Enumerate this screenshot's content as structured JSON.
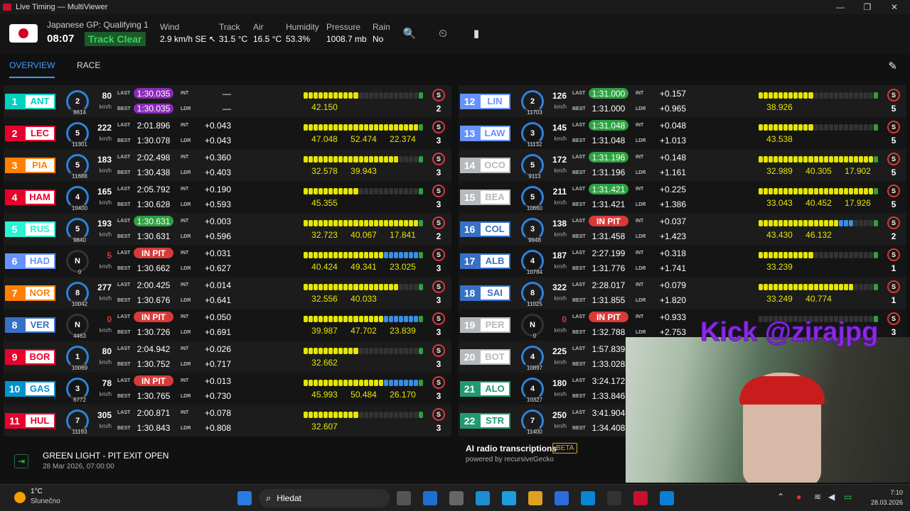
{
  "window": {
    "title": "Live Timing — MultiViewer"
  },
  "header": {
    "session": "Japanese GP: Qualifying 1",
    "clock": "08:07",
    "status": "Track Clear",
    "weather": [
      {
        "label": "Wind",
        "value": "2.9 km/h SE ↖"
      },
      {
        "label": "Track",
        "value": "31.5 °C"
      },
      {
        "label": "Air",
        "value": "16.5 °C"
      },
      {
        "label": "Humidity",
        "value": "53.3%"
      },
      {
        "label": "Pressure",
        "value": "1008.7 mb"
      },
      {
        "label": "Rain",
        "value": "No"
      }
    ]
  },
  "tabs": {
    "overview": "OVERVIEW",
    "race": "RACE"
  },
  "labels": {
    "last": "LAST",
    "best": "BEST",
    "int": "INT",
    "ldr": "LDR",
    "kmh": "km/h"
  },
  "colors": {
    "purple": "#8a2bb8",
    "green": "#2ea041",
    "pit": "#d83a3a",
    "yellow": "#e6e600"
  },
  "drivers": [
    {
      "pos": "1",
      "code": "ANT",
      "team": "#00d2be",
      "gear": "2",
      "rpm": "8614",
      "speed": "80",
      "last": "1:30.035",
      "lastStyle": "purple",
      "best": "1:30.035",
      "bestStyle": "purple",
      "int": "—",
      "ldr": "—",
      "s1": "42.150",
      "s2": "",
      "s3": "",
      "tyre": "S",
      "laps": "2"
    },
    {
      "pos": "2",
      "code": "LEC",
      "team": "#e8002d",
      "gear": "5",
      "rpm": "11301",
      "speed": "222",
      "last": "2:01.896",
      "lastStyle": "",
      "best": "1:30.078",
      "bestStyle": "",
      "int": "+0.043",
      "ldr": "+0.043",
      "s1": "47.048",
      "s2": "52.474",
      "s3": "22.374",
      "tyre": "S",
      "laps": "3"
    },
    {
      "pos": "3",
      "code": "PIA",
      "team": "#ff8000",
      "gear": "5",
      "rpm": "11688",
      "speed": "183",
      "last": "2:02.498",
      "lastStyle": "",
      "best": "1:30.438",
      "bestStyle": "",
      "int": "+0.360",
      "ldr": "+0.403",
      "s1": "32.578",
      "s2": "39.943",
      "s3": "",
      "tyre": "S",
      "laps": "3"
    },
    {
      "pos": "4",
      "code": "HAM",
      "team": "#e8002d",
      "gear": "4",
      "rpm": "10400",
      "speed": "165",
      "last": "2:05.792",
      "lastStyle": "",
      "best": "1:30.628",
      "bestStyle": "",
      "int": "+0.190",
      "ldr": "+0.593",
      "s1": "45.355",
      "s2": "",
      "s3": "",
      "tyre": "S",
      "laps": "3"
    },
    {
      "pos": "5",
      "code": "RUS",
      "team": "#27f4d2",
      "gear": "5",
      "rpm": "9840",
      "speed": "193",
      "last": "1:30.631",
      "lastStyle": "green",
      "best": "1:30.631",
      "bestStyle": "",
      "int": "+0.003",
      "ldr": "+0.596",
      "s1": "32.723",
      "s2": "40.067",
      "s3": "17.841",
      "tyre": "S",
      "laps": "2"
    },
    {
      "pos": "6",
      "code": "HAD",
      "team": "#6692ff",
      "gear": "N",
      "rpm": "0",
      "speed": "5",
      "last": "IN PIT",
      "lastStyle": "pit",
      "best": "1:30.662",
      "bestStyle": "",
      "int": "+0.031",
      "ldr": "+0.627",
      "s1": "40.424",
      "s2": "49.341",
      "s3": "23.025",
      "tyre": "S",
      "laps": "3"
    },
    {
      "pos": "7",
      "code": "NOR",
      "team": "#ff8000",
      "gear": "8",
      "rpm": "10042",
      "speed": "277",
      "last": "2:00.425",
      "lastStyle": "",
      "best": "1:30.676",
      "bestStyle": "",
      "int": "+0.014",
      "ldr": "+0.641",
      "s1": "32.556",
      "s2": "40.033",
      "s3": "",
      "tyre": "S",
      "laps": "3"
    },
    {
      "pos": "8",
      "code": "VER",
      "team": "#3671c6",
      "gear": "N",
      "rpm": "4463",
      "speed": "0",
      "last": "IN PIT",
      "lastStyle": "pit",
      "best": "1:30.726",
      "bestStyle": "",
      "int": "+0.050",
      "ldr": "+0.691",
      "s1": "39.987",
      "s2": "47.702",
      "s3": "23.839",
      "tyre": "S",
      "laps": "3"
    },
    {
      "pos": "9",
      "code": "BOR",
      "team": "#e8002d",
      "gear": "1",
      "rpm": "10069",
      "speed": "80",
      "last": "2:04.942",
      "lastStyle": "",
      "best": "1:30.752",
      "bestStyle": "",
      "int": "+0.026",
      "ldr": "+0.717",
      "s1": "32.662",
      "s2": "",
      "s3": "",
      "tyre": "S",
      "laps": "3"
    },
    {
      "pos": "10",
      "code": "GAS",
      "team": "#0093cc",
      "gear": "3",
      "rpm": "6772",
      "speed": "78",
      "last": "IN PIT",
      "lastStyle": "pit",
      "best": "1:30.765",
      "bestStyle": "",
      "int": "+0.013",
      "ldr": "+0.730",
      "s1": "45.993",
      "s2": "50.484",
      "s3": "26.170",
      "tyre": "S",
      "laps": "3"
    },
    {
      "pos": "11",
      "code": "HUL",
      "team": "#e8002d",
      "gear": "7",
      "rpm": "11193",
      "speed": "305",
      "last": "2:00.871",
      "lastStyle": "",
      "best": "1:30.843",
      "bestStyle": "",
      "int": "+0.078",
      "ldr": "+0.808",
      "s1": "32.607",
      "s2": "",
      "s3": "",
      "tyre": "S",
      "laps": "3"
    },
    {
      "pos": "12",
      "code": "LIN",
      "team": "#6692ff",
      "gear": "2",
      "rpm": "11703",
      "speed": "126",
      "last": "1:31.000",
      "lastStyle": "green",
      "best": "1:31.000",
      "bestStyle": "",
      "int": "+0.157",
      "ldr": "+0.965",
      "s1": "38.926",
      "s2": "",
      "s3": "",
      "tyre": "S",
      "laps": "5"
    },
    {
      "pos": "13",
      "code": "LAW",
      "team": "#6692ff",
      "gear": "3",
      "rpm": "11132",
      "speed": "145",
      "last": "1:31.048",
      "lastStyle": "green",
      "best": "1:31.048",
      "bestStyle": "",
      "int": "+0.048",
      "ldr": "+1.013",
      "s1": "43.538",
      "s2": "",
      "s3": "",
      "tyre": "S",
      "laps": "5"
    },
    {
      "pos": "14",
      "code": "OCO",
      "team": "#b6babd",
      "gear": "5",
      "rpm": "9113",
      "speed": "172",
      "last": "1:31.196",
      "lastStyle": "green",
      "best": "1:31.196",
      "bestStyle": "",
      "int": "+0.148",
      "ldr": "+1.161",
      "s1": "32.989",
      "s2": "40.305",
      "s3": "17.902",
      "tyre": "S",
      "laps": "5"
    },
    {
      "pos": "15",
      "code": "BEA",
      "team": "#b6babd",
      "gear": "5",
      "rpm": "10660",
      "speed": "211",
      "last": "1:31.421",
      "lastStyle": "green",
      "best": "1:31.421",
      "bestStyle": "",
      "int": "+0.225",
      "ldr": "+1.386",
      "s1": "33.043",
      "s2": "40.452",
      "s3": "17.926",
      "tyre": "S",
      "laps": "5"
    },
    {
      "pos": "16",
      "code": "COL",
      "team": "#3671c6",
      "gear": "3",
      "rpm": "9948",
      "speed": "138",
      "last": "IN PIT",
      "lastStyle": "pit",
      "best": "1:31.458",
      "bestStyle": "",
      "int": "+0.037",
      "ldr": "+1.423",
      "s1": "43.430",
      "s2": "46.132",
      "s3": "",
      "tyre": "S",
      "laps": "2"
    },
    {
      "pos": "17",
      "code": "ALB",
      "team": "#3671c6",
      "gear": "4",
      "rpm": "10784",
      "speed": "187",
      "last": "2:27.199",
      "lastStyle": "",
      "best": "1:31.776",
      "bestStyle": "",
      "int": "+0.318",
      "ldr": "+1.741",
      "s1": "33.239",
      "s2": "",
      "s3": "",
      "tyre": "S",
      "laps": "1"
    },
    {
      "pos": "18",
      "code": "SAI",
      "team": "#3671c6",
      "gear": "8",
      "rpm": "11025",
      "speed": "322",
      "last": "2:28.017",
      "lastStyle": "",
      "best": "1:31.855",
      "bestStyle": "",
      "int": "+0.079",
      "ldr": "+1.820",
      "s1": "33.249",
      "s2": "40.774",
      "s3": "",
      "tyre": "S",
      "laps": "1"
    },
    {
      "pos": "19",
      "code": "PER",
      "team": "#b6babd",
      "gear": "N",
      "rpm": "0",
      "speed": "0",
      "last": "IN PIT",
      "lastStyle": "pit",
      "best": "1:32.788",
      "bestStyle": "",
      "int": "+0.933",
      "ldr": "+2.753",
      "s1": "",
      "s2": "",
      "s3": "",
      "tyre": "S",
      "laps": "3"
    },
    {
      "pos": "20",
      "code": "BOT",
      "team": "#b6babd",
      "gear": "4",
      "rpm": "10897",
      "speed": "225",
      "last": "1:57.839",
      "lastStyle": "",
      "best": "1:33.028",
      "bestStyle": "",
      "int": "",
      "ldr": "",
      "s1": "",
      "s2": "",
      "s3": "",
      "tyre": "",
      "laps": ""
    },
    {
      "pos": "21",
      "code": "ALO",
      "team": "#229971",
      "gear": "4",
      "rpm": "10327",
      "speed": "180",
      "last": "3:24.172",
      "lastStyle": "",
      "best": "1:33.846",
      "bestStyle": "",
      "int": "",
      "ldr": "",
      "s1": "",
      "s2": "",
      "s3": "",
      "tyre": "",
      "laps": ""
    },
    {
      "pos": "22",
      "code": "STR",
      "team": "#229971",
      "gear": "7",
      "rpm": "11400",
      "speed": "250",
      "last": "3:41.904",
      "lastStyle": "",
      "best": "1:34.408",
      "bestStyle": "",
      "int": "",
      "ldr": "",
      "s1": "",
      "s2": "",
      "s3": "",
      "tyre": "",
      "laps": ""
    }
  ],
  "race_control": {
    "message": "GREEN LIGHT - PIT EXIT OPEN",
    "time": "28 Mar 2026, 07:00:00"
  },
  "radio": {
    "title": "AI radio transcriptions",
    "badge": "BETA",
    "powered": "powered by recursiveGecko"
  },
  "overlay": {
    "text": "Kick @zirajpg"
  },
  "taskbar": {
    "temp": "1°C",
    "weather": "Slunečno",
    "search": "Hledat",
    "time": "7:10",
    "date": "28.03.2026"
  }
}
